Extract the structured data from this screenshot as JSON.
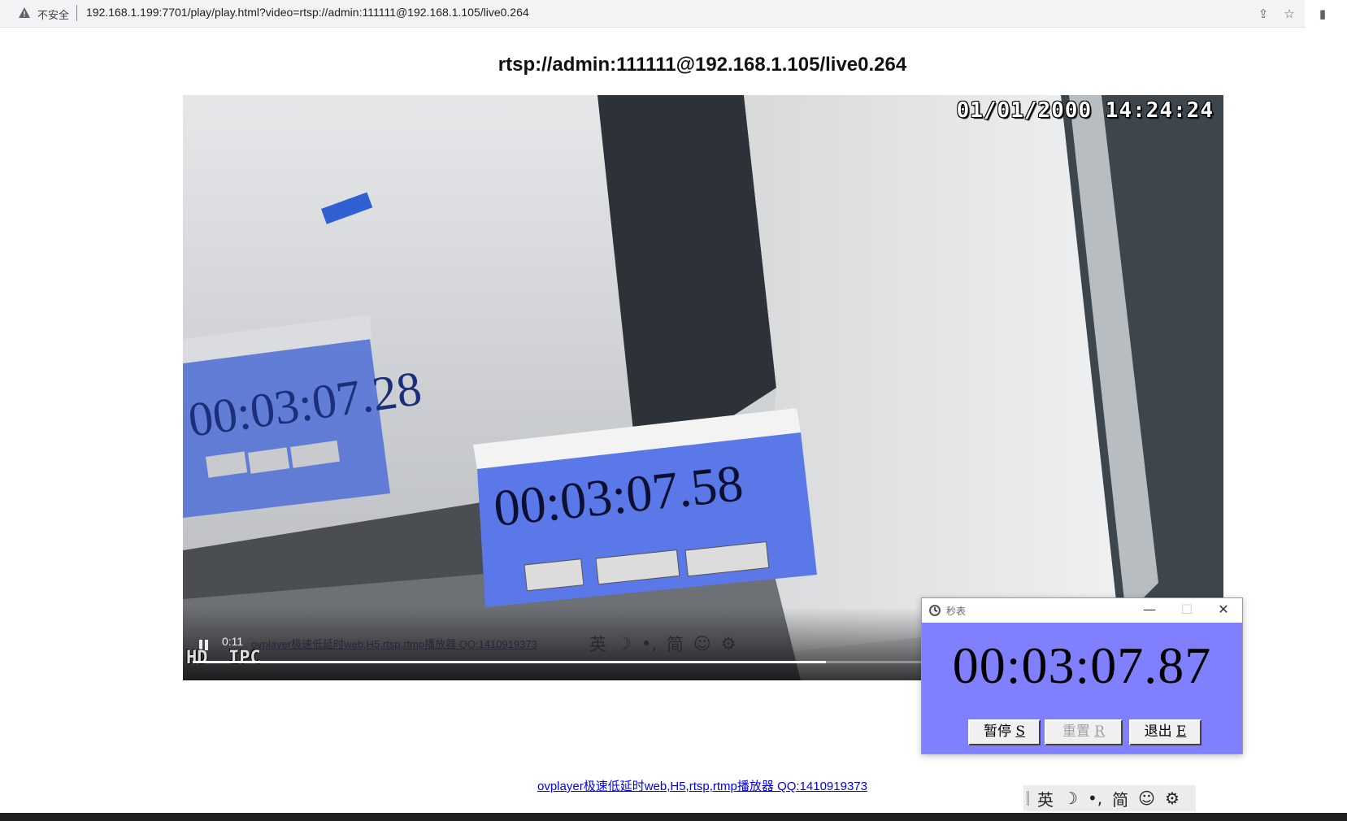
{
  "browser": {
    "security_label": "不安全",
    "url": "192.168.1.199:7701/play/play.html?video=rtsp://admin:111111@192.168.1.105/live0.264",
    "icons": [
      "warning-icon",
      "share-icon",
      "bookmark-star-icon",
      "sidepanel-icon",
      "profile-icon"
    ]
  },
  "page": {
    "title": "rtsp://admin:111111@192.168.1.105/live0.264",
    "footer_link": "ovplayer极速低延时web,H5,rtsp,rtmp播放器 QQ:1410919373"
  },
  "video": {
    "osd_datetime": "01/01/2000 14:24:24",
    "osd_hd": "HD",
    "osd_ipc": "IPC",
    "elapsed": "0:11",
    "watermark": "ovplayer极速低延时web,H5,rtsp,rtmp播放器 QQ:1410919373",
    "progress": 0.62,
    "captured_stopwatch_front": "00:03:07.58",
    "captured_stopwatch_back": "00:03:07.28"
  },
  "stopwatch": {
    "title": "秒表",
    "display": "00:03:07.87",
    "pause_label": "暂停",
    "pause_key": "S",
    "reset_label": "重置",
    "reset_key": "R",
    "exit_label": "退出",
    "exit_key": "E",
    "minimize": "—",
    "maximize": "☐",
    "close": "✕",
    "bg_color": "#8080ff"
  },
  "ime": {
    "lang": "英",
    "moon": "☽",
    "punct": "•,",
    "simplified": "简",
    "emoji": "☺",
    "settings": "⚙"
  }
}
